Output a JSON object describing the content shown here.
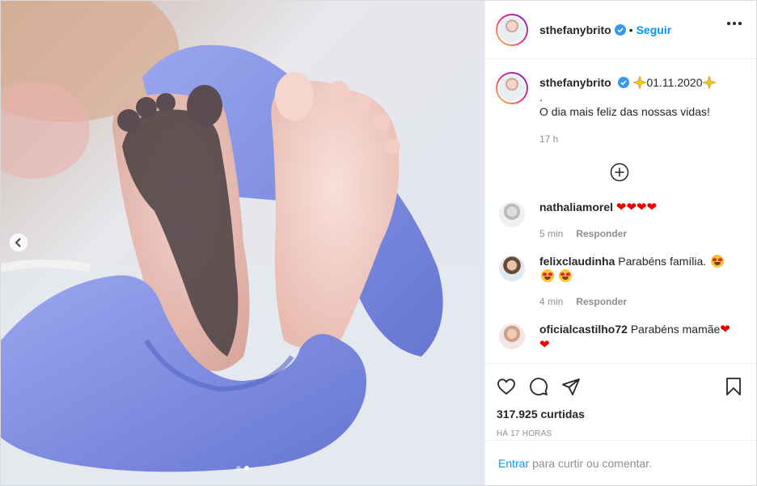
{
  "post": {
    "author": "sthefanybrito",
    "follow_label": "Seguir",
    "separator": "•",
    "caption_date": "01.11.2020",
    "caption_dot": ".",
    "caption_text": "O dia mais feliz das nossas vidas!",
    "caption_age": "17 h"
  },
  "comments": [
    {
      "user": "nathaliamorel",
      "text": "",
      "age": "5 min",
      "reply": "Responder"
    },
    {
      "user": "felixclaudinha",
      "text": "Parabéns família.",
      "age": "4 min",
      "reply": "Responder"
    },
    {
      "user": "oficialcastilho72",
      "text": "Parabéns mamãe",
      "age": "",
      "reply": ""
    }
  ],
  "actions": {
    "likes": "317.925 curtidas",
    "posted": "HÁ 17 HORAS"
  },
  "login": {
    "enter": "Entrar",
    "rest": "para curtir ou comentar."
  },
  "colors": {
    "accent": "#0095f6",
    "glove": "#7f8fe0",
    "muted": "#8e8e8e"
  },
  "icons": [
    "chevron-left-icon",
    "verified-badge-icon",
    "more-icon",
    "add-comment-icon",
    "heart-icon",
    "comment-icon",
    "share-icon",
    "bookmark-icon"
  ],
  "carousel": {
    "slides": 2,
    "active_slide": 2
  }
}
